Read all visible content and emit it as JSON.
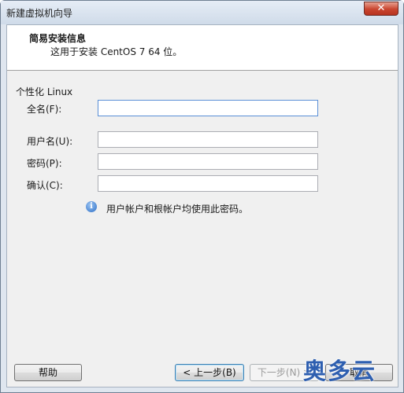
{
  "window": {
    "title": "新建虚拟机向导",
    "close_glyph": "✕"
  },
  "header": {
    "title": "简易安装信息",
    "subtitle": "这用于安装 CentOS 7 64 位。"
  },
  "section": {
    "title": "个性化 Linux"
  },
  "fields": {
    "fullname": {
      "label": "全名(F):",
      "value": ""
    },
    "username": {
      "label": "用户名(U):",
      "value": ""
    },
    "password": {
      "label": "密码(P):",
      "value": ""
    },
    "confirm": {
      "label": "确认(C):",
      "value": ""
    }
  },
  "info": {
    "icon": "info-icon",
    "glyph": "i",
    "text": "用户帐户和根帐户均使用此密码。"
  },
  "buttons": {
    "help": "帮助",
    "back": "< 上一步(B)",
    "next": "下一步(N) >",
    "cancel": "取消"
  },
  "watermark": "奥多云",
  "colors": {
    "title_close": "#c9452f",
    "header_bg": "#ffffff",
    "dialog_bg": "#f0f0f0",
    "watermark": "#2e5fb0"
  }
}
